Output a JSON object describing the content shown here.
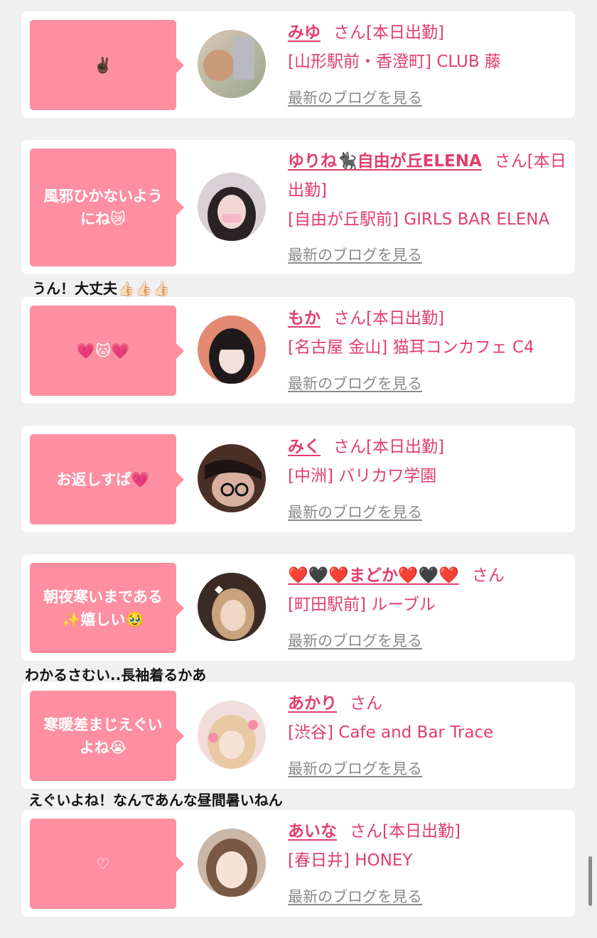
{
  "entries": [
    {
      "message": "✌🏿",
      "name": "みゆ",
      "san": "さん",
      "status": "[本日出勤]",
      "location": "[山形駅前・香澄町] CLUB 藤",
      "blog_link": "最新のブログを見る"
    },
    {
      "message": "風邪ひかないようにね😿",
      "name": "ゆりね🐈‍⬛自由が丘ELENA",
      "san": "さん",
      "status": "[本日出勤]",
      "location": "[自由が丘駅前] GIRLS BAR ELENA",
      "blog_link": "最新のブログを見る"
    },
    {
      "message": "💗🐱💗",
      "name": "もか",
      "san": "さん",
      "status": "[本日出勤]",
      "location": "[名古屋 金山] 猫耳コンカフェ C4",
      "blog_link": "最新のブログを見る"
    },
    {
      "message": "お返しすぱ💗",
      "name": "みく",
      "san": "さん",
      "status": "[本日出勤]",
      "location": "[中洲] バリカワ学園",
      "blog_link": "最新のブログを見る"
    },
    {
      "message": "朝夜寒いまである✨嬉しい🥹",
      "name": "❤️🖤❤️まどか❤️🖤❤️",
      "san": "さん",
      "status": "",
      "location": "[町田駅前] ルーブル",
      "blog_link": "最新のブログを見る"
    },
    {
      "message": "寒暖差まじえぐいよね😭",
      "name": "あかり",
      "san": "さん",
      "status": "",
      "location": "[渋谷] Cafe and Bar Trace",
      "blog_link": "最新のブログを見る"
    },
    {
      "message": "♡",
      "name": "あいな",
      "san": "さん",
      "status": "[本日出勤]",
      "location": "[春日井] HONEY",
      "blog_link": "最新のブログを見る"
    }
  ],
  "replies": [
    "うん！大丈夫👍🏻👍🏻👍🏻",
    "わかるさむい..長袖着るかあ",
    "えぐいよね！なんであんな昼間暑いねん"
  ],
  "colors": {
    "bubble": "#fd8fa1",
    "name_text": "#e23e6b",
    "blog_link": "#8a8a8a",
    "page_bg": "#f0f0f0"
  }
}
